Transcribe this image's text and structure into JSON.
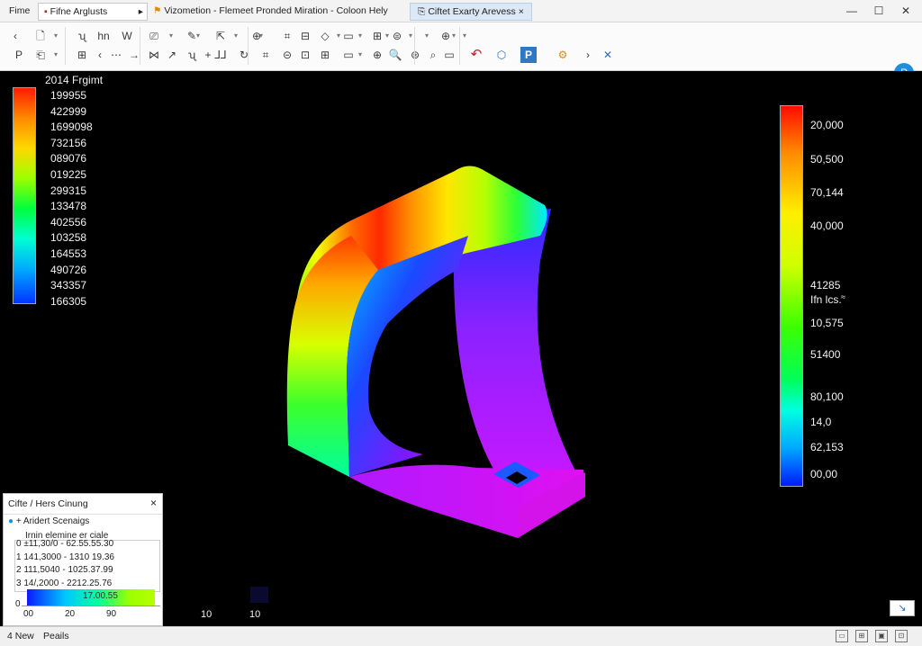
{
  "titlebar": {
    "menu_label": "Fime",
    "tabs": [
      "Fifne Arglusts",
      "Vizometion - Flemeet Pronded Miration - Coloon Hely",
      "Ciftet Exarty Arevess"
    ],
    "tab_arrow": "▸",
    "tab_close": "×",
    "minimize": "—",
    "maximize": "☐",
    "close": "✕"
  },
  "ribbon": {
    "row1": [
      "‹",
      "🗋",
      "▾",
      "ʯ",
      "hn",
      "W",
      "⎚",
      "▾",
      "✎",
      "▾",
      "⇱",
      "▾",
      "⊕",
      "▾",
      "⌗",
      "⊟",
      "◇",
      "▾",
      "▭",
      "▾",
      "⊞",
      "▾",
      "⊜",
      "▾",
      "▾",
      "⊕",
      "▾",
      "▾"
    ],
    "row2": [
      "P",
      "⎗",
      "▾",
      "⊞",
      "‹",
      "⋯",
      "→",
      "⋈",
      "↗",
      "ʯ",
      "+",
      "⅃⅃",
      "↻",
      "⌗",
      "⊝",
      "⊡",
      "⊞",
      "▭",
      "▾",
      "⊕",
      "🔍",
      "⊛",
      "⌕",
      "▭",
      "↶",
      "⬡",
      "P",
      "⚙",
      "›",
      "✕"
    ],
    "avatar": "P"
  },
  "left_legend": {
    "title": "2014 Frgimt",
    "values": [
      "199955",
      "422999",
      "1699098",
      "732156",
      "089076",
      "019225",
      "299315",
      "133478",
      "402556",
      "103258",
      "164553",
      "490726",
      "343357",
      "166305"
    ],
    "colors": [
      "#ff1a00",
      "#ff8a00",
      "#ffd800",
      "#9cff00",
      "#00ff3c",
      "#00ffd2",
      "#00aaff",
      "#0033ff"
    ]
  },
  "right_legend": {
    "values": [
      "20,000",
      "50,500",
      "70,144",
      "40,000",
      "41285",
      "Ifn lcs.",
      "10,575",
      "51400",
      "80,100",
      "14,0",
      "62,153",
      "00,00"
    ],
    "side_label": "≈",
    "colors": [
      "#ff0a00",
      "#ff8800",
      "#ffee00",
      "#cfff00",
      "#3cff00",
      "#00ff5a",
      "#00ffe0",
      "#00a8ff",
      "#0018ff"
    ]
  },
  "panel": {
    "title": "Cifte / Hers Cinung",
    "close": "×",
    "section": "+ Aridert Scenaigs",
    "subheader": "Irnin elemine er ciale",
    "rows": [
      "0 ±11,30/0 - 62.55.55.30",
      "1 141,3000 - 1310 19.36",
      "2 111,5040 - 1025.37.99",
      "3 14/,2000 - 2212.25.76"
    ],
    "y_zero": "0",
    "bar_label": "17.00.55",
    "ticks": [
      "00",
      "20",
      "90",
      "10",
      "10"
    ]
  },
  "statusbar": {
    "left": "4 New",
    "mid": "Peails"
  },
  "corner_badge": "↘",
  "colors": {
    "accent_blue": "#1b8fe0",
    "viewport_bg": "#000000"
  }
}
